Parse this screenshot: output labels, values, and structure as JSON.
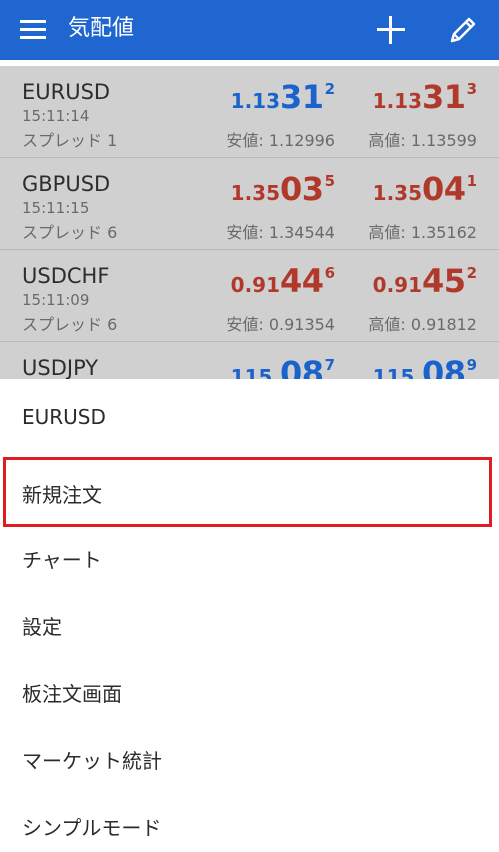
{
  "appbar": {
    "title": "気配値",
    "bg_color": "#1f66d1",
    "icons": {
      "menu": "hamburger-menu-icon",
      "add": "plus-icon",
      "edit": "pencil-icon"
    }
  },
  "colors": {
    "up": "#1a63cc",
    "down": "#b0392b",
    "highlight": "#e01b24"
  },
  "quotes": [
    {
      "symbol": "EURUSD",
      "time": "15:11:14",
      "spread": "スプレッド 1",
      "bid": {
        "base": "1.13",
        "big": "31",
        "sup": "2",
        "color": "blue"
      },
      "ask": {
        "base": "1.13",
        "big": "31",
        "sup": "3",
        "color": "red"
      },
      "low": "安値: 1.12996",
      "high": "高値: 1.13599"
    },
    {
      "symbol": "GBPUSD",
      "time": "15:11:15",
      "spread": "スプレッド 6",
      "bid": {
        "base": "1.35",
        "big": "03",
        "sup": "5",
        "color": "red"
      },
      "ask": {
        "base": "1.35",
        "big": "04",
        "sup": "1",
        "color": "red"
      },
      "low": "安値: 1.34544",
      "high": "高値: 1.35162"
    },
    {
      "symbol": "USDCHF",
      "time": "15:11:09",
      "spread": "スプレッド 6",
      "bid": {
        "base": "0.91",
        "big": "44",
        "sup": "6",
        "color": "red"
      },
      "ask": {
        "base": "0.91",
        "big": "45",
        "sup": "2",
        "color": "red"
      },
      "low": "安値: 0.91354",
      "high": "高値: 0.91812"
    },
    {
      "symbol": "USDJPY",
      "time": "",
      "spread": "",
      "bid": {
        "base": "115.",
        "big": "08",
        "sup": "7",
        "color": "blue"
      },
      "ask": {
        "base": "115.",
        "big": "08",
        "sup": "9",
        "color": "blue"
      },
      "low": "",
      "high": ""
    }
  ],
  "context_menu": {
    "title": "EURUSD",
    "items": [
      {
        "label": "新規注文",
        "highlighted": true
      },
      {
        "label": "チャート"
      },
      {
        "label": "設定"
      },
      {
        "label": "板注文画面"
      },
      {
        "label": "マーケット統計"
      },
      {
        "label": "シンプルモード"
      }
    ]
  }
}
